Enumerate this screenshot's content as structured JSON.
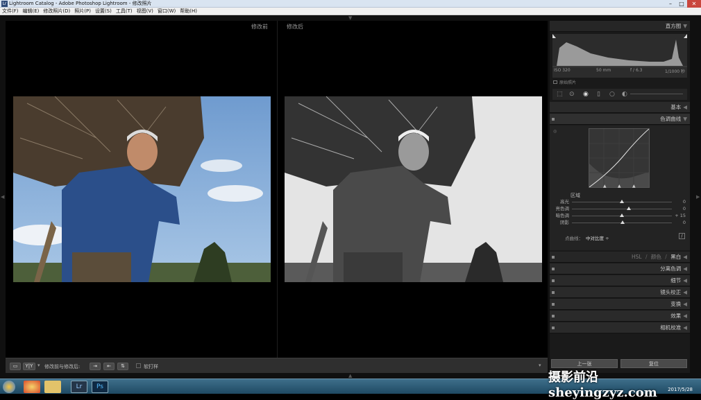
{
  "window": {
    "title": "Lightroom Catalog - Adobe Photoshop Lightroom - 修改照片"
  },
  "menu": [
    "文件(F)",
    "编辑(E)",
    "修改照片(D)",
    "照片(P)",
    "设置(S)",
    "工具(T)",
    "视图(V)",
    "窗口(W)",
    "帮助(H)"
  ],
  "compare": {
    "before_label": "修改前",
    "after_label": "修改后"
  },
  "toolbar": {
    "view_icon": "loupe-view-icon",
    "yy_label": "Y|Y",
    "before_after_label": "修改前与修改后:",
    "softproof_label": "软打样"
  },
  "histogram": {
    "title": "直方图",
    "iso": "ISO 320",
    "focal": "50 mm",
    "aperture": "f / 6.3",
    "shutter": "1/1000 秒",
    "original_photo": "原始照片"
  },
  "sections": {
    "basic": "基本",
    "tone_curve": "色调曲线",
    "split_toning": "分离色调",
    "detail": "细节",
    "lens": "镜头校正",
    "transform": "变换",
    "effects": "效果",
    "camera_calibration": "相机校准"
  },
  "hsl_tabs": {
    "hsl": "HSL",
    "color": "颜色",
    "bw": "黑白",
    "sep1": "/",
    "sep2": "/"
  },
  "tone_region": {
    "title": "区域",
    "sliders": [
      {
        "label": "高光",
        "value": "0",
        "pos": 0.5
      },
      {
        "label": "亮色调",
        "value": "0",
        "pos": 0.5
      },
      {
        "label": "暗色调",
        "value": "+ 15",
        "pos": 0.57
      },
      {
        "label": "阴影",
        "value": "0",
        "pos": 0.5
      }
    ],
    "point_curve_label": "点曲线：",
    "point_curve_value": "中对比度 ÷"
  },
  "buttons": {
    "previous": "上一张",
    "reset": "复位"
  },
  "watermark": "摄影前沿 sheyingzyz.com",
  "taskbar": {
    "date": "2017/5/28",
    "lr_label": "Lr",
    "ps_label": "Ps"
  },
  "colors": {
    "panel_bg": "#1a1a1a",
    "section_header": "#2a2a2a",
    "sky": "#8db3d9",
    "shirt": "#2b4f8a"
  }
}
